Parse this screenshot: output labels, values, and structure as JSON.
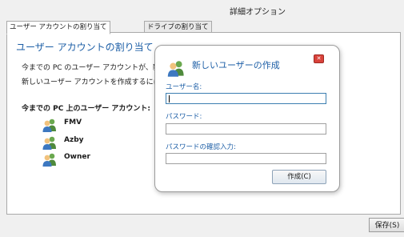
{
  "window": {
    "title": "詳細オプション"
  },
  "tabs": [
    {
      "label": "ユーザー アカウントの割り当て",
      "active": true
    },
    {
      "label": "ドライブの割り当て",
      "active": false
    }
  ],
  "panel": {
    "heading": "ユーザー アカウントの割り当て",
    "paragraph1": "今までの PC のユーザー アカウントが、新しい PC",
    "paragraph2": "新しいユーザー アカウントを作成するには、次のド",
    "accounts_heading": "今までの PC 上のユーザー アカウント:",
    "accounts": [
      {
        "name": "FMV",
        "icon": "users-icon"
      },
      {
        "name": "Azby",
        "icon": "users-icon"
      },
      {
        "name": "Owner",
        "icon": "users-icon"
      }
    ]
  },
  "footer": {
    "save_label": "保存(S)"
  },
  "dialog": {
    "title": "新しいユーザーの作成",
    "icon": "users-icon",
    "close_icon": "close-icon",
    "username_label": "ユーザー名:",
    "username_value": "",
    "password_label": "パスワード:",
    "password_value": "",
    "confirm_label": "パスワードの確認入力:",
    "confirm_value": "",
    "create_label": "作成(C)"
  },
  "colors": {
    "accent": "#1c5ea6",
    "close": "#d9423a"
  }
}
